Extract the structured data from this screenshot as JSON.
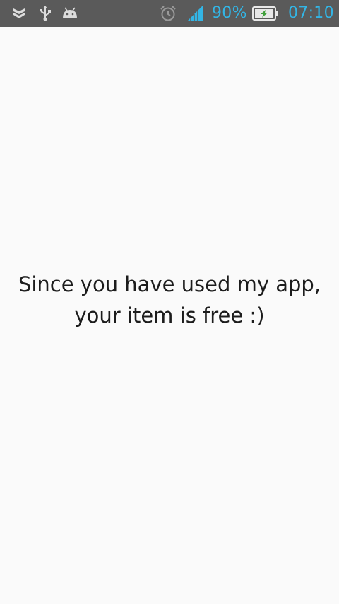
{
  "status_bar": {
    "left_icons": [
      "shield-chevron-icon",
      "usb-icon",
      "android-debug-icon"
    ],
    "right_icons": [
      "alarm-icon",
      "signal-icon",
      "battery-charging-icon"
    ],
    "battery_percent": "90%",
    "time": "07:10",
    "accent_color": "#33b5e5",
    "background_color": "#5a5a5a"
  },
  "main": {
    "message_line1": "Since you have used my app,",
    "message_line2": "your item is free :)"
  }
}
